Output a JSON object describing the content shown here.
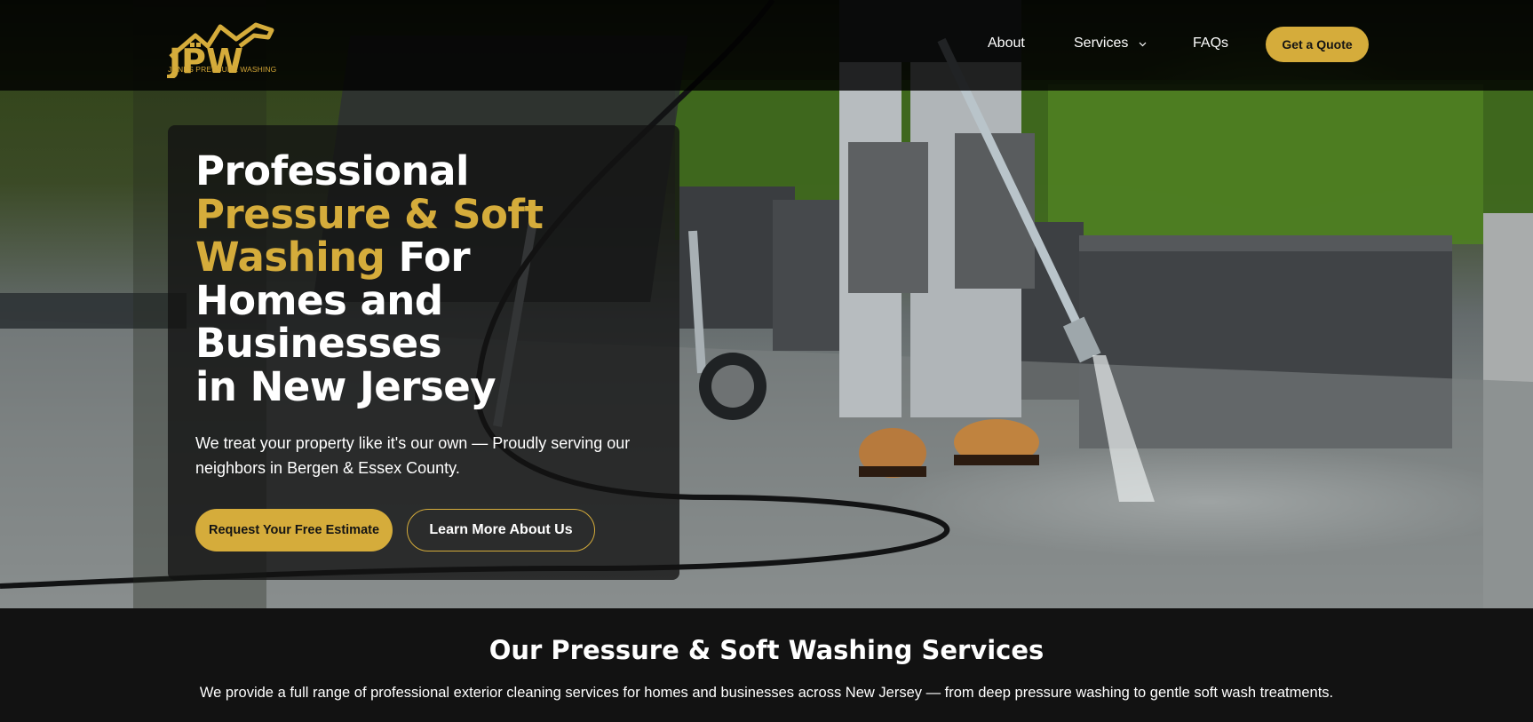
{
  "brand": {
    "logo_text": "JONES PRESSURE WASHING",
    "gold": "#d5ac3b"
  },
  "nav": {
    "links": [
      "About",
      "Services",
      "FAQs"
    ],
    "cta": "Get a Quote",
    "services_dropdown_icon": "chevron-down-icon"
  },
  "hero": {
    "headline_line1": "Professional",
    "headline_gold": "Pressure & Soft Washing",
    "headline_rest_1": "For",
    "headline_rest_2": "Homes and Businesses",
    "headline_rest_3": "in New Jersey",
    "subtext": "We treat your property like it's our own — Proudly serving our neighbors in Bergen & Essex County.",
    "primary_button": "Request Your Free Estimate",
    "secondary_button": "Learn More About Us"
  },
  "services": {
    "title": "Our Pressure & Soft Washing Services",
    "description": "We provide a full range of professional exterior cleaning services for homes and businesses across New Jersey — from deep pressure washing to gentle soft wash treatments."
  }
}
